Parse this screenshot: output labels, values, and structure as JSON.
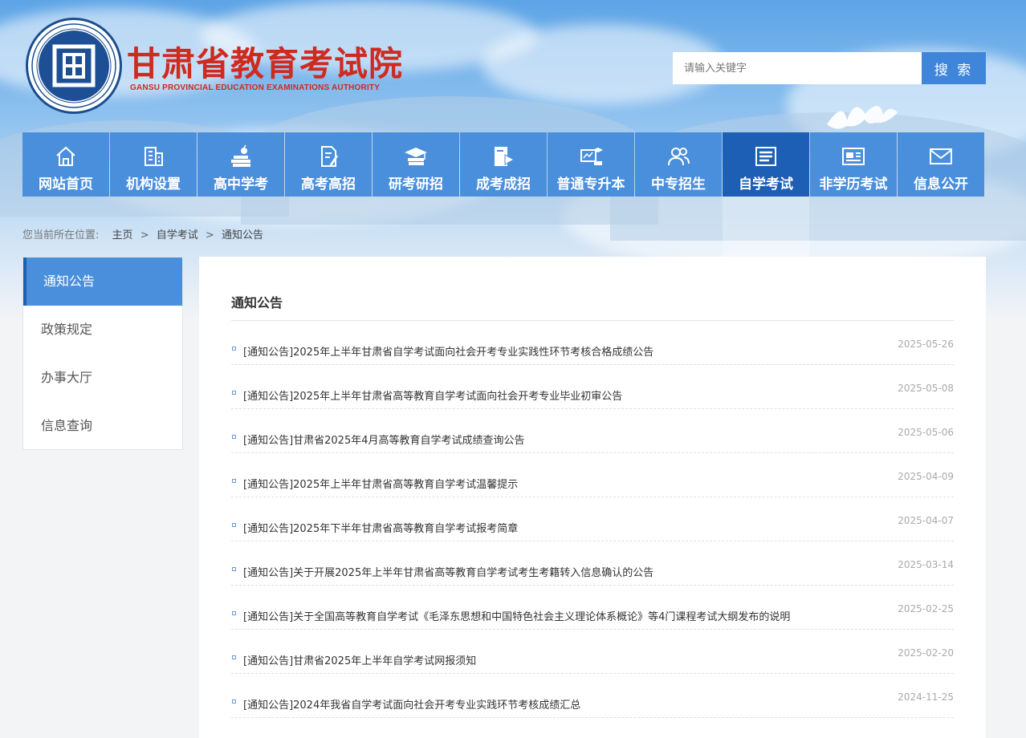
{
  "header": {
    "org_name": "甘肃省教育考试院",
    "org_name_en": "GANSU PROVINCIAL EDUCATION EXAMINATIONS AUTHORITY",
    "logo": "seal-logo",
    "title_color": "#cf2a1f"
  },
  "search": {
    "placeholder": "请输入关键字",
    "button_label": "搜 索"
  },
  "nav": {
    "items": [
      {
        "label": "网站首页",
        "icon": "home-icon"
      },
      {
        "label": "机构设置",
        "icon": "building-icon"
      },
      {
        "label": "高中学考",
        "icon": "books-apple-icon"
      },
      {
        "label": "高考高招",
        "icon": "document-pen-icon"
      },
      {
        "label": "研考研招",
        "icon": "graduation-cap-icon"
      },
      {
        "label": "成考成招",
        "icon": "file-video-icon"
      },
      {
        "label": "普通专升本",
        "icon": "board-graduate-icon"
      },
      {
        "label": "中专招生",
        "icon": "users-icon"
      },
      {
        "label": "自学考试",
        "icon": "article-icon",
        "active": true
      },
      {
        "label": "非学历考试",
        "icon": "id-card-icon"
      },
      {
        "label": "信息公开",
        "icon": "mail-icon"
      }
    ],
    "accent": "#4a8fdc",
    "active_color": "#1d5fb5"
  },
  "breadcrumb": {
    "prefix": "您当前所在位置:",
    "items": [
      "主页",
      "自学考试",
      "通知公告"
    ],
    "separator": ">"
  },
  "sidebar": {
    "items": [
      {
        "label": "通知公告",
        "active": true
      },
      {
        "label": "政策规定"
      },
      {
        "label": "办事大厅"
      },
      {
        "label": "信息查询"
      }
    ]
  },
  "main": {
    "title": "通知公告",
    "list": [
      {
        "title": "[通知公告]2025年上半年甘肃省自学考试面向社会开考专业实践性环节考核合格成绩公告",
        "date": "2025-05-26"
      },
      {
        "title": "[通知公告]2025年上半年甘肃省高等教育自学考试面向社会开考专业毕业初审公告",
        "date": "2025-05-08"
      },
      {
        "title": "[通知公告]甘肃省2025年4月高等教育自学考试成绩查询公告",
        "date": "2025-05-06"
      },
      {
        "title": "[通知公告]2025年上半年甘肃省高等教育自学考试温馨提示",
        "date": "2025-04-09"
      },
      {
        "title": "[通知公告]2025年下半年甘肃省高等教育自学考试报考简章",
        "date": "2025-04-07"
      },
      {
        "title": "[通知公告]关于开展2025年上半年甘肃省高等教育自学考试考生考籍转入信息确认的公告",
        "date": "2025-03-14"
      },
      {
        "title": "[通知公告]关于全国高等教育自学考试《毛泽东思想和中国特色社会主义理论体系概论》等4门课程考试大纲发布的说明",
        "date": "2025-02-25"
      },
      {
        "title": "[通知公告]甘肃省2025年上半年自学考试网报须知",
        "date": "2025-02-20"
      },
      {
        "title": "[通知公告]2024年我省自学考试面向社会开考专业实践环节考核成绩汇总",
        "date": "2024-11-25"
      }
    ]
  }
}
